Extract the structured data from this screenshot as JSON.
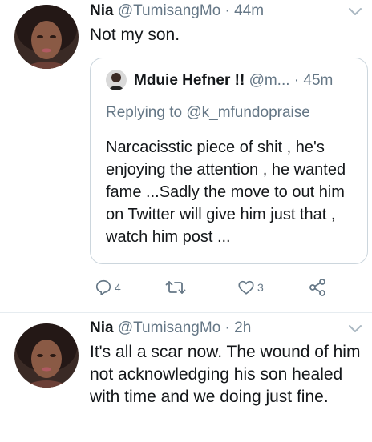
{
  "tweets": [
    {
      "name": "Nia",
      "handle": "@TumisangMo",
      "separator": "·",
      "time": "44m",
      "text": "Not my son.",
      "quote": {
        "name": "Mduie Hefner !!",
        "handle": "@m...",
        "separator": "·",
        "time": "45m",
        "replying_to": "Replying to @k_mfundopraise",
        "text": "Narcacisstic piece of shit , he's enjoying the attention , he wanted fame ...Sadly the move to out him on Twitter will give him just that , watch him post ..."
      },
      "actions": {
        "reply_count": "4",
        "like_count": "3"
      }
    },
    {
      "name": "Nia",
      "handle": "@TumisangMo",
      "separator": "·",
      "time": "2h",
      "text": "It's all a scar now. The wound of him not acknowledging his son healed with time and we doing just fine."
    }
  ],
  "colors": {
    "text": "#14171a",
    "secondary": "#657786",
    "border": "#ccd6dd",
    "divider": "#e6ecf0"
  },
  "icons": {
    "reply": "reply-icon",
    "retweet": "retweet-icon",
    "like": "like-icon",
    "share": "share-icon",
    "caret": "chevron-down-icon"
  }
}
